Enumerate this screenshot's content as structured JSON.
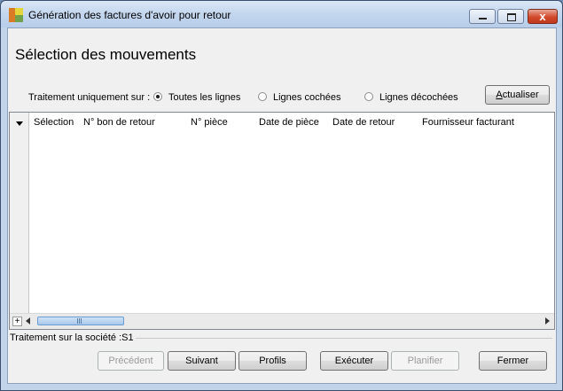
{
  "window": {
    "title": "Génération des factures d'avoir pour retour",
    "controls": {
      "minimize": "minimize-icon",
      "maximize": "maximize-icon",
      "close": "close-icon",
      "close_glyph": "x"
    }
  },
  "page": {
    "title": "Sélection des mouvements"
  },
  "filter": {
    "label": "Traitement uniquement sur :",
    "options": [
      {
        "label": "Toutes les lignes",
        "selected": true
      },
      {
        "label": "Lignes cochées",
        "selected": false
      },
      {
        "label": "Lignes décochées",
        "selected": false
      }
    ],
    "refresh": {
      "prefix": "A",
      "rest": "ctualiser"
    }
  },
  "grid": {
    "columns": [
      "Sélection",
      "N° bon de retour",
      "N° pièce",
      "Date de pièce",
      "Date de retour",
      "Fournisseur facturant"
    ],
    "rows": [],
    "add_symbol": "+"
  },
  "status": {
    "company": "Traitement sur la société :S1"
  },
  "buttons": {
    "previous": "Précédent",
    "next": "Suivant",
    "profiles": "Profils",
    "execute": "Exécuter",
    "schedule": "Planifier",
    "close": "Fermer"
  },
  "colors": {
    "frame": "#c2d4ea",
    "client_bg": "#f0f0f0",
    "close_button": "#d2492b",
    "scroll_thumb": "#a9c8ea"
  }
}
